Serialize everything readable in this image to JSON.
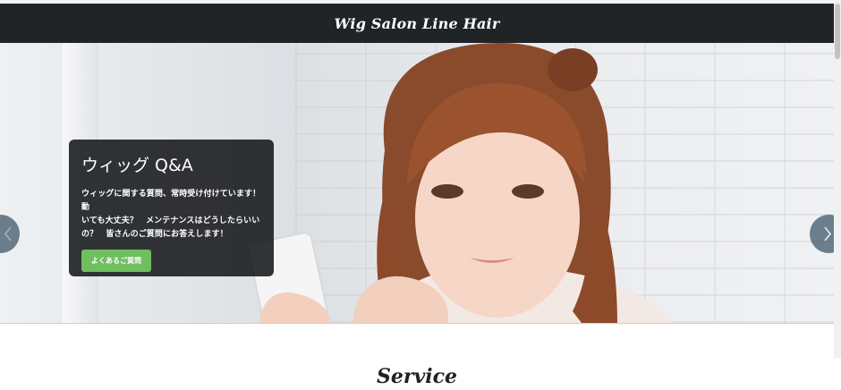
{
  "header": {
    "brand": "Wig Salon Line Hair"
  },
  "hero": {
    "slide": {
      "title": "ウィッグ Q&A",
      "text_line1": "ウィッグに関する質問、常時受け付けています！動",
      "text_line2": "いても大丈夫？　メンテナンスはどうしたらいい",
      "text_line3": "の？　皆さんのご質問にお答えします！",
      "button_label": "よくあるご質問"
    },
    "controls": {
      "prev_icon": "chevron-left-icon",
      "next_icon": "chevron-right-icon"
    }
  },
  "section": {
    "heading": "Service"
  },
  "colors": {
    "navbar": "#212427",
    "caption_bg": "#16181a",
    "button_green": "#6fbf5f",
    "control_bg": "#465c6e"
  }
}
